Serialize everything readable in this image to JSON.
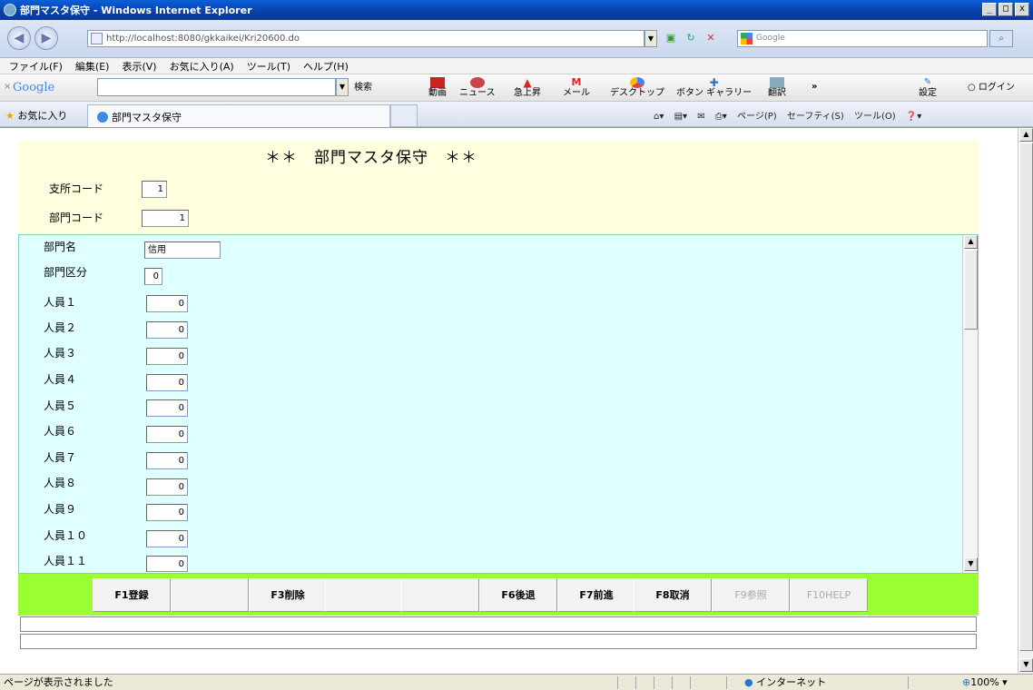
{
  "browser": {
    "window_title": "部門マスタ保守 - Windows Internet Explorer",
    "address": "http://localhost:8080/gkkaikei/Kri20600.do",
    "search_placeholder": "Google",
    "menu": [
      "ファイル(F)",
      "編集(E)",
      "表示(V)",
      "お気に入り(A)",
      "ツール(T)",
      "ヘルプ(H)"
    ],
    "google_toolbar": {
      "logo": "Google",
      "search_label": "検索",
      "items": [
        "動画",
        "ニュース",
        "急上昇",
        "メール",
        "デスクトップ",
        "ボタン ギャラリー",
        "翻訳"
      ],
      "settings": "設定",
      "login": "ログイン",
      "more": "»"
    },
    "favorites_label": "お気に入り",
    "tab_title": "部門マスタ保守",
    "command_bar": [
      "ページ(P)",
      "セーフティ(S)",
      "ツール(O)"
    ],
    "status_text": "ページが表示されました",
    "zone": "インターネット",
    "zoom": "100%"
  },
  "form": {
    "title": "＊＊　部門マスタ保守　＊＊",
    "header_fields": [
      {
        "label": "支所コード",
        "value": "1"
      },
      {
        "label": "部門コード",
        "value": "1"
      }
    ],
    "dept_name": {
      "label": "部門名",
      "value": "信用"
    },
    "dept_class": {
      "label": "部門区分",
      "value": "0"
    },
    "staff": [
      {
        "label": "人員１",
        "value": "0"
      },
      {
        "label": "人員２",
        "value": "0"
      },
      {
        "label": "人員３",
        "value": "0"
      },
      {
        "label": "人員４",
        "value": "0"
      },
      {
        "label": "人員５",
        "value": "0"
      },
      {
        "label": "人員６",
        "value": "0"
      },
      {
        "label": "人員７",
        "value": "0"
      },
      {
        "label": "人員８",
        "value": "0"
      },
      {
        "label": "人員９",
        "value": "0"
      },
      {
        "label": "人員１０",
        "value": "0"
      },
      {
        "label": "人員１１",
        "value": "0"
      }
    ],
    "function_keys": [
      {
        "label": "F1登録",
        "enabled": true
      },
      {
        "label": "",
        "enabled": true
      },
      {
        "label": "F3削除",
        "enabled": true
      },
      {
        "label": "",
        "enabled": true
      },
      {
        "label": "",
        "enabled": true
      },
      {
        "label": "F6後退",
        "enabled": true
      },
      {
        "label": "F7前進",
        "enabled": true
      },
      {
        "label": "F8取消",
        "enabled": true
      },
      {
        "label": "F9参照",
        "enabled": false
      },
      {
        "label": "F10HELP",
        "enabled": false
      }
    ]
  },
  "colors": {
    "header_bg": "#ffffe0",
    "detail_bg": "#e0ffff",
    "fkey_bar_bg": "#99ff33"
  }
}
